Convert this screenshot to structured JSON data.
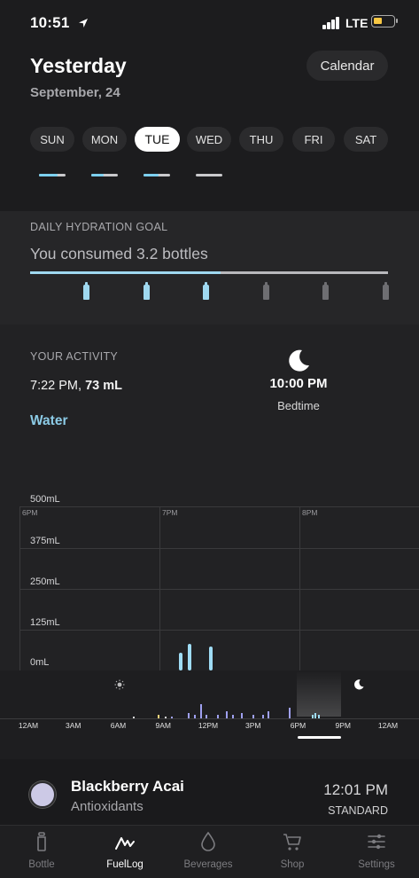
{
  "status_bar": {
    "time": "10:51",
    "network": "LTE",
    "icons": [
      "location-arrow-icon",
      "signal-bars-icon",
      "battery-icon"
    ]
  },
  "header": {
    "title": "Yesterday",
    "date": "September, 24",
    "calendar_label": "Calendar"
  },
  "days": {
    "items": [
      {
        "label": "SUN",
        "active": false,
        "progress": 0.7
      },
      {
        "label": "MON",
        "active": false,
        "progress": 0.45
      },
      {
        "label": "TUE",
        "active": true,
        "progress": 0.55
      },
      {
        "label": "WED",
        "active": false,
        "progress": 0.0
      },
      {
        "label": "THU",
        "active": false,
        "progress": null
      },
      {
        "label": "FRI",
        "active": false,
        "progress": null
      },
      {
        "label": "SAT",
        "active": false,
        "progress": null
      }
    ],
    "colors": {
      "filled": "#7cd0ef",
      "empty": "#c9c9cc"
    }
  },
  "goal": {
    "label": "DAILY HYDRATION GOAL",
    "summary": "You consumed 3.2 bottles",
    "bottles_consumed": 3.2,
    "bottles_total": 6,
    "colors": {
      "filled": "#9fd8f0",
      "empty": "#6e6e72"
    }
  },
  "activity": {
    "label": "YOUR ACTIVITY",
    "time": "7:22 PM,",
    "amount": "73 mL",
    "drink_type": "Water",
    "bedtime_time": "10:00 PM",
    "bedtime_label": "Bedtime",
    "icons": [
      "moon-icon"
    ]
  },
  "chart_data": {
    "type": "bar",
    "y_labels": [
      "500mL",
      "375mL",
      "250mL",
      "125mL",
      "0mL"
    ],
    "ylim": [
      0,
      500
    ],
    "x_labels": [
      "6PM",
      "7PM",
      "8PM"
    ],
    "xlim": [
      "6PM",
      "9PM"
    ],
    "series": [
      {
        "x": [
          "7:09 PM",
          "7:13 PM",
          "7:22 PM"
        ],
        "values": [
          53,
          80,
          73
        ]
      }
    ],
    "selected": "7:22 PM",
    "bar_color": "#9fdcf5"
  },
  "timeline": {
    "labels": [
      "12AM",
      "3AM",
      "6AM",
      "9AM",
      "12PM",
      "3PM",
      "6PM",
      "9PM",
      "12AM"
    ],
    "icons": [
      "sun-icon",
      "moon-icon"
    ],
    "window": [
      "6PM",
      "9PM"
    ]
  },
  "drink": {
    "name": "Blackberry Acai",
    "category": "Antioxidants",
    "time": "12:01 PM",
    "size": "STANDARD",
    "color": "#ccc9e6"
  },
  "tabs": [
    {
      "label": "Bottle",
      "icon": "bottle-icon",
      "active": false
    },
    {
      "label": "FuelLog",
      "icon": "fuellog-icon",
      "active": true
    },
    {
      "label": "Beverages",
      "icon": "drop-icon",
      "active": false
    },
    {
      "label": "Shop",
      "icon": "cart-icon",
      "active": false
    },
    {
      "label": "Settings",
      "icon": "sliders-icon",
      "active": false
    }
  ]
}
